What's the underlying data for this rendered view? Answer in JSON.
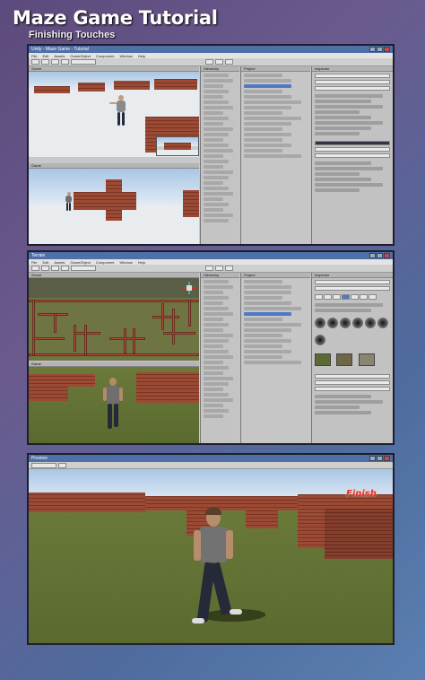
{
  "header": {
    "title": "Maze Game Tutorial",
    "subtitle": "Finishing Touches"
  },
  "screen1": {
    "window_title": "Unity - Maze Game - Tutorial",
    "menu": [
      "File",
      "Edit",
      "Assets",
      "GameObject",
      "Component",
      "Window",
      "Help"
    ],
    "scene_tab": "Scene",
    "game_tab": "Game",
    "hierarchy_tab": "Hierarchy",
    "project_tab": "Project",
    "inspector_tab": "Inspector"
  },
  "screen2": {
    "window_title": "Terrain",
    "menu": [
      "File",
      "Edit",
      "Assets",
      "GameObject",
      "Component",
      "Window",
      "Help"
    ],
    "scene_tab": "Scene",
    "game_tab": "Game",
    "hierarchy_tab": "Hierarchy",
    "project_tab": "Project",
    "inspector_tab": "Inspector"
  },
  "screen3": {
    "window_title": "Preview",
    "finish_text": "Finish"
  },
  "colors": {
    "background_start": "#5c4a7c",
    "background_end": "#5a7fb0",
    "unity_bar": "#4e6fa8",
    "brick": "#9b4a34",
    "grass": "#6b7a3a",
    "finish_red": "#e8302a"
  }
}
